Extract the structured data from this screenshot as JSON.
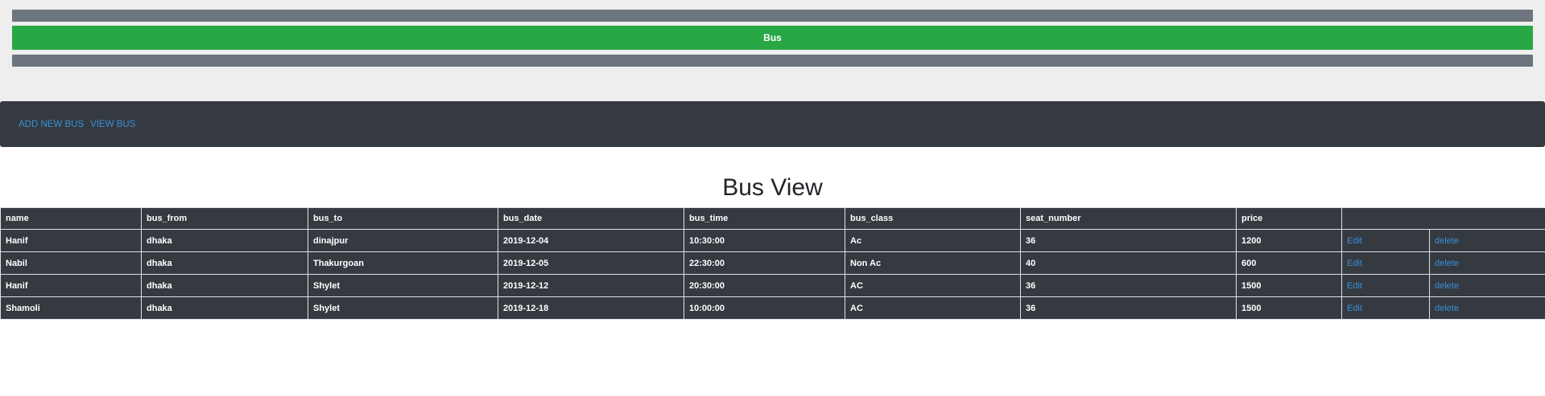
{
  "banner": {
    "title": "Bus"
  },
  "nav": {
    "items": [
      {
        "label": "ADD NEW BUS"
      },
      {
        "label": "VIEW BUS"
      }
    ]
  },
  "page": {
    "title": "Bus View"
  },
  "table": {
    "columns": [
      "name",
      "bus_from",
      "bus_to",
      "bus_date",
      "bus_time",
      "bus_class",
      "seat_number",
      "price",
      ""
    ],
    "rows": [
      {
        "name": "Hanif",
        "bus_from": "dhaka",
        "bus_to": "dinajpur",
        "bus_date": "2019-12-04",
        "bus_time": "10:30:00",
        "bus_class": "Ac",
        "seat_number": "36",
        "price": "1200",
        "edit": "Edit",
        "delete": "delete"
      },
      {
        "name": "Nabil",
        "bus_from": "dhaka",
        "bus_to": "Thakurgoan",
        "bus_date": "2019-12-05",
        "bus_time": "22:30:00",
        "bus_class": "Non Ac",
        "seat_number": "40",
        "price": "600",
        "edit": "Edit",
        "delete": "delete"
      },
      {
        "name": "Hanif",
        "bus_from": "dhaka",
        "bus_to": "Shylet",
        "bus_date": "2019-12-12",
        "bus_time": "20:30:00",
        "bus_class": "AC",
        "seat_number": "36",
        "price": "1500",
        "edit": "Edit",
        "delete": "delete"
      },
      {
        "name": "Shamoli",
        "bus_from": "dhaka",
        "bus_to": "Shylet",
        "bus_date": "2019-12-18",
        "bus_time": "10:00:00",
        "bus_class": "AC",
        "seat_number": "36",
        "price": "1500",
        "edit": "Edit",
        "delete": "delete"
      }
    ]
  },
  "colors": {
    "gray_bar": "#6c757d",
    "green_bar": "#28a745",
    "dark": "#343a40",
    "link": "#3a8fd9"
  }
}
